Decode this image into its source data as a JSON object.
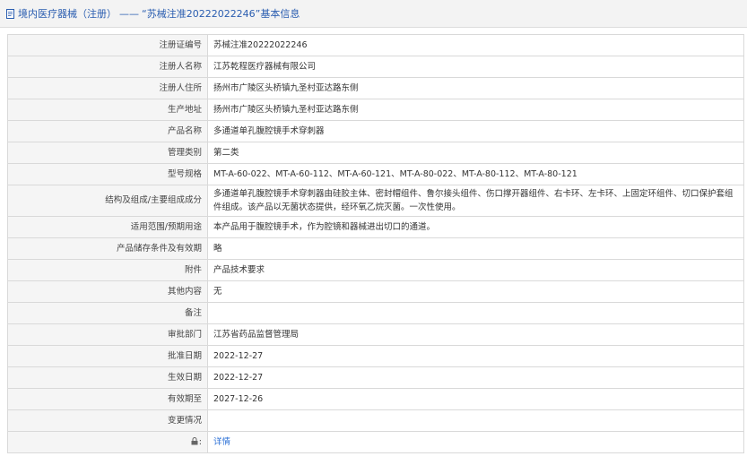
{
  "header": {
    "icon": "document-icon",
    "title": "境内医疗器械（注册）",
    "separator": "——",
    "subtitle": "“苏械注准20222022246”基本信息"
  },
  "rows": [
    {
      "label": "注册证编号",
      "value": "苏械注准20222022246"
    },
    {
      "label": "注册人名称",
      "value": "江苏乾程医疗器械有限公司"
    },
    {
      "label": "注册人住所",
      "value": "扬州市广陵区头桥镇九圣村亚达路东侧"
    },
    {
      "label": "生产地址",
      "value": "扬州市广陵区头桥镇九圣村亚达路东侧"
    },
    {
      "label": "产品名称",
      "value": "多通道单孔腹腔镜手术穿刺器"
    },
    {
      "label": "管理类别",
      "value": "第二类"
    },
    {
      "label": "型号规格",
      "value": "MT-A-60-022、MT-A-60-112、MT-A-60-121、MT-A-80-022、MT-A-80-112、MT-A-80-121"
    },
    {
      "label": "结构及组成/主要组成成分",
      "value": "多通道单孔腹腔镜手术穿刺器由硅胶主体、密封帽组件、鲁尔接头组件、伤口撑开器组件、右卡环、左卡环、上固定环组件、切口保护套组件组成。该产品以无菌状态提供，经环氧乙烷灭菌。一次性使用。"
    },
    {
      "label": "适用范围/预期用途",
      "value": "本产品用于腹腔镜手术，作为腔镜和器械进出切口的通道。"
    },
    {
      "label": "产品储存条件及有效期",
      "value": "略"
    },
    {
      "label": "附件",
      "value": "产品技术要求"
    },
    {
      "label": "其他内容",
      "value": "无"
    },
    {
      "label": "备注",
      "value": ""
    },
    {
      "label": "审批部门",
      "value": "江苏省药品监督管理局"
    },
    {
      "label": "批准日期",
      "value": "2022-12-27"
    },
    {
      "label": "生效日期",
      "value": "2022-12-27"
    },
    {
      "label": "有效期至",
      "value": "2027-12-26"
    },
    {
      "label": "变更情况",
      "value": ""
    }
  ],
  "footer_row": {
    "label_icon": "lock-icon",
    "link": "详情"
  },
  "colors": {
    "link": "#2a6fd6",
    "header_text": "#2a5db0",
    "label_bg": "#f5f5f5"
  }
}
